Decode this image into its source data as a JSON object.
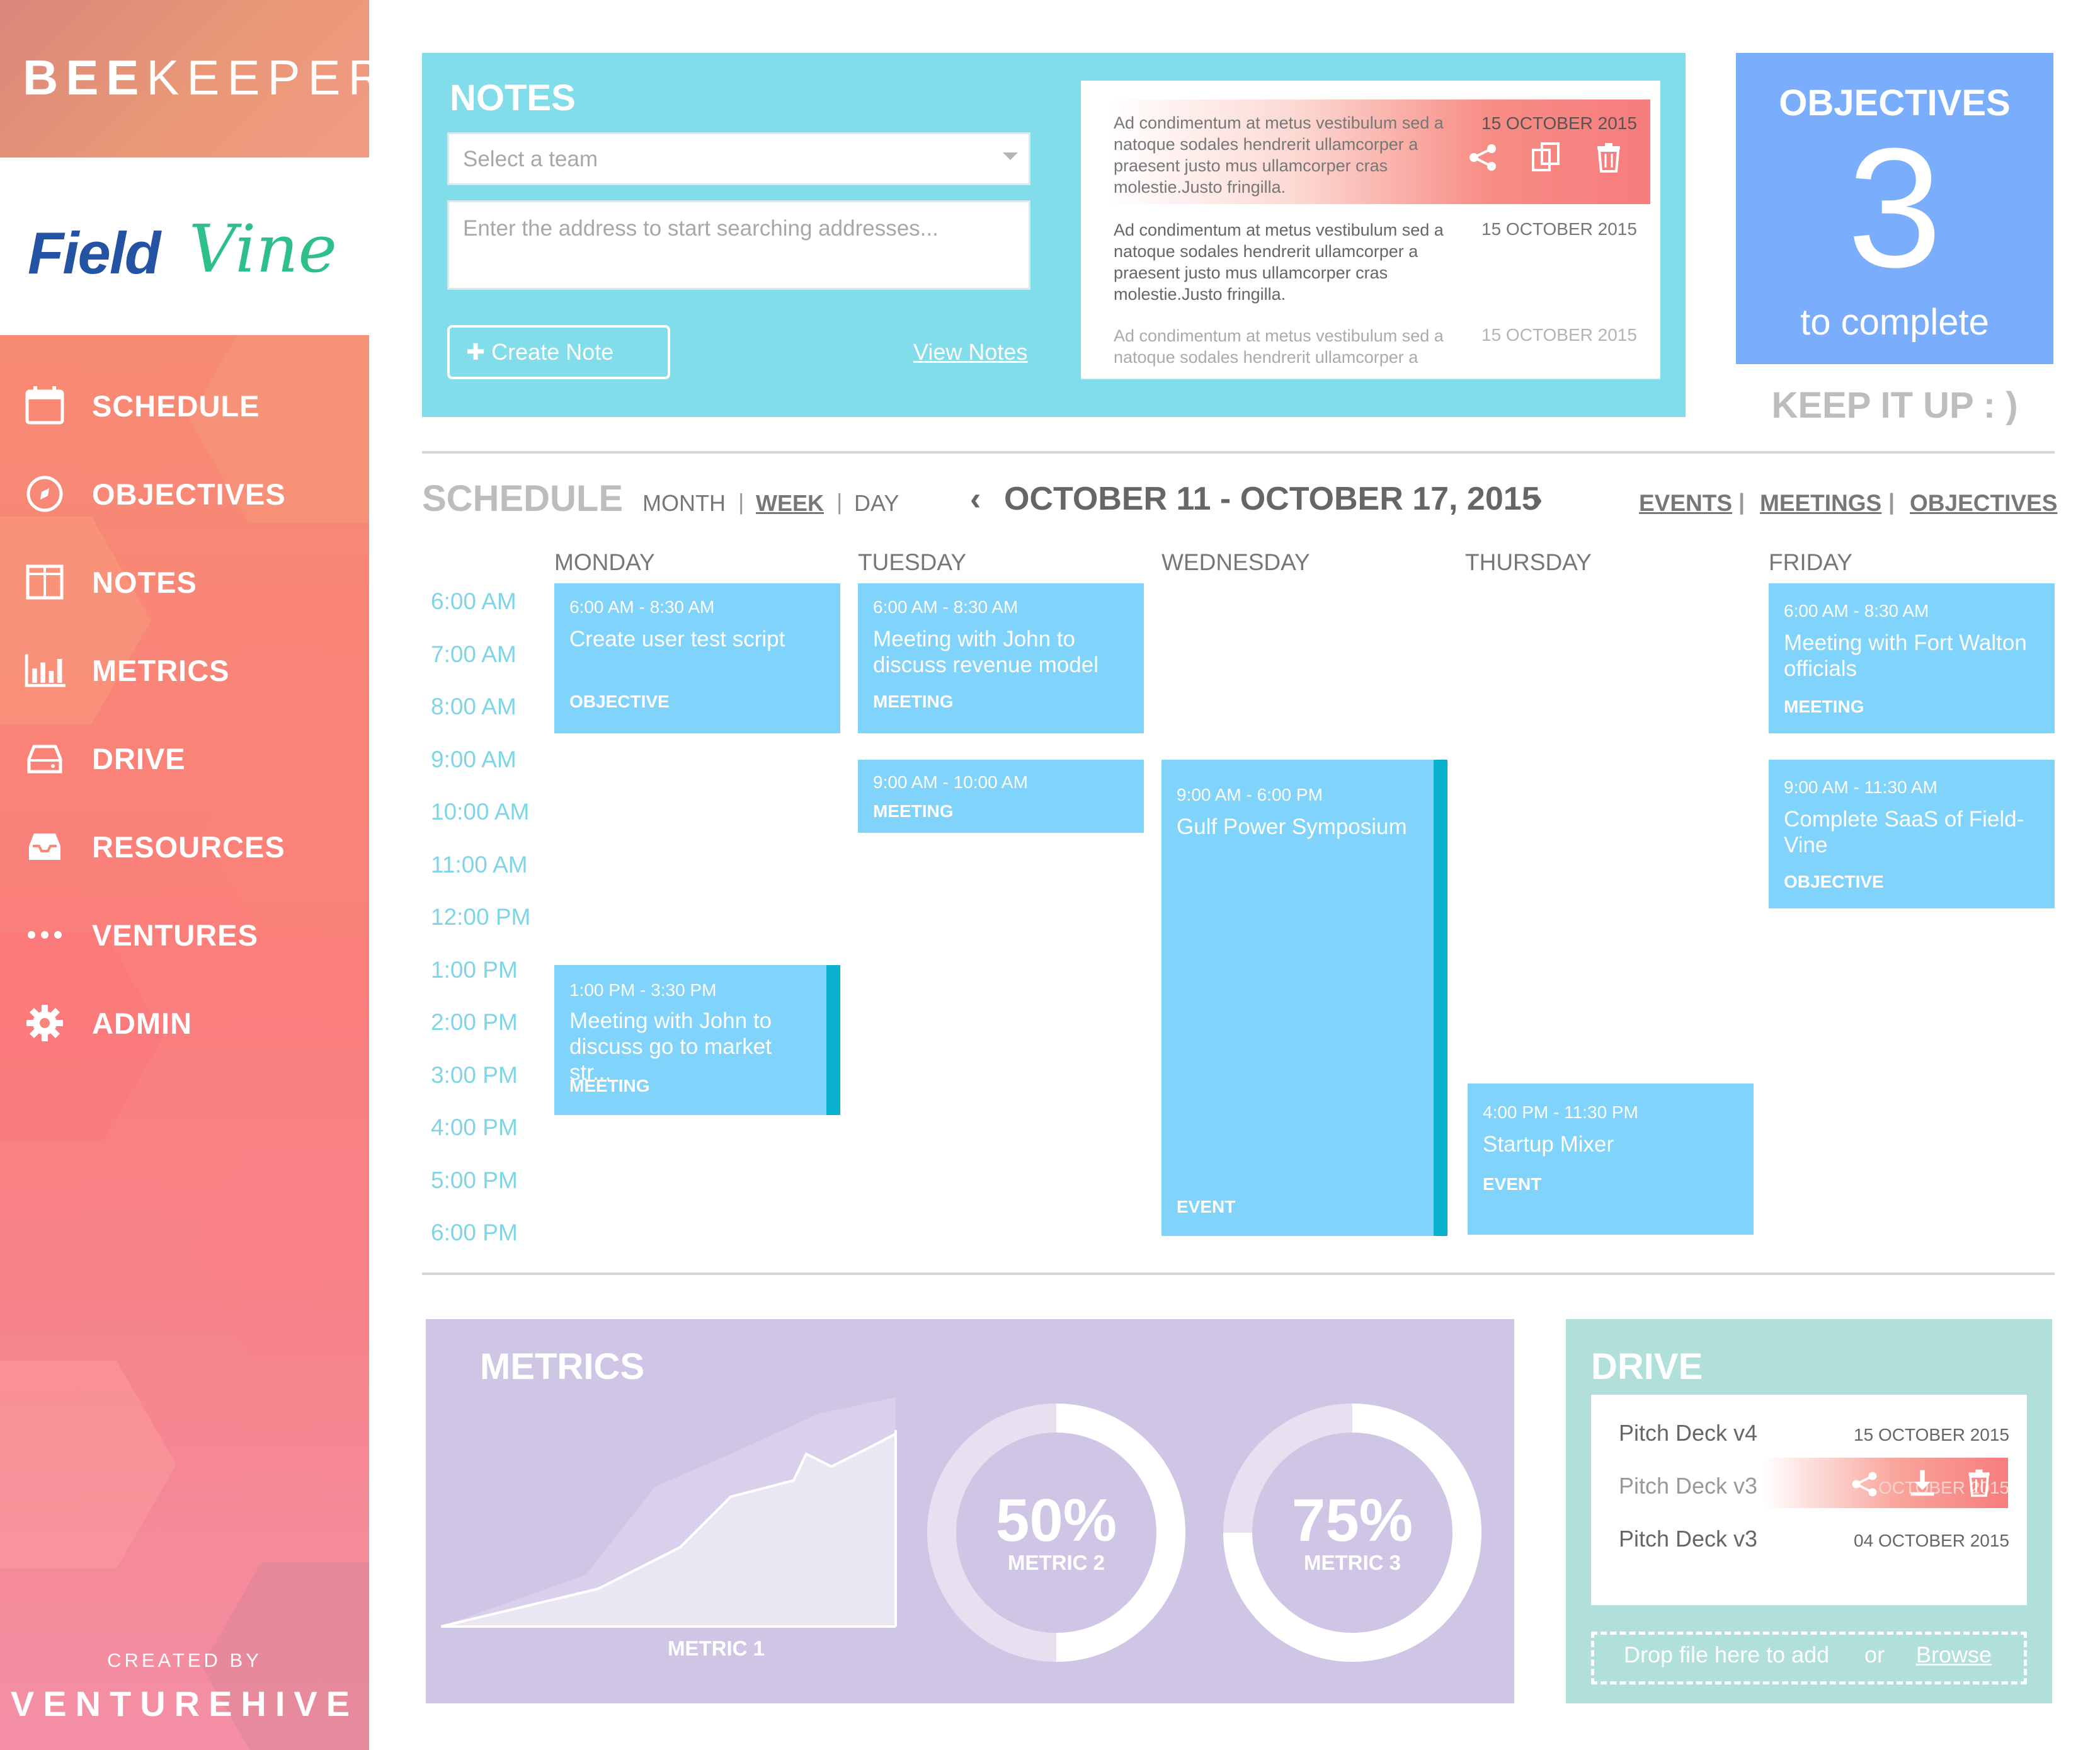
{
  "brand": {
    "name_bold": "BEE",
    "name_light": "KEEPER",
    "partner_part1": "Field",
    "partner_part2": "Vine"
  },
  "nav": [
    {
      "label": "SCHEDULE",
      "icon": "calendar-icon"
    },
    {
      "label": "OBJECTIVES",
      "icon": "compass-icon"
    },
    {
      "label": "NOTES",
      "icon": "notes-icon"
    },
    {
      "label": "METRICS",
      "icon": "bar-chart-icon"
    },
    {
      "label": "DRIVE",
      "icon": "drive-icon"
    },
    {
      "label": "RESOURCES",
      "icon": "inbox-icon"
    },
    {
      "label": "VENTURES",
      "icon": "more-icon"
    },
    {
      "label": "ADMIN",
      "icon": "gear-icon"
    }
  ],
  "footer": {
    "created_by": "CREATED BY",
    "company": "VENTUREHIVE"
  },
  "notes": {
    "title": "NOTES",
    "team_placeholder": "Select a team",
    "address_placeholder": "Enter the address to start searching addresses...",
    "create_label": "✚ Create Note",
    "view_label": "View Notes",
    "items": [
      {
        "text": "Ad condimentum at metus vestibulum sed a natoque sodales hendrerit ullamcorper a praesent justo mus ullamcorper cras molestie.Justo fringilla.",
        "date": "15 OCTOBER 2015"
      },
      {
        "text": "Ad condimentum at metus vestibulum sed a natoque sodales hendrerit ullamcorper a praesent justo mus ullamcorper cras molestie.Justo fringilla.",
        "date": "15 OCTOBER 2015"
      },
      {
        "text": "Ad condimentum at metus vestibulum sed a natoque sodales hendrerit ullamcorper a",
        "date": "15 OCTOBER 2015"
      }
    ]
  },
  "objectives": {
    "title": "OBJECTIVES",
    "count": "3",
    "subtitle": "to complete",
    "motto": "KEEP IT UP : )"
  },
  "schedule": {
    "title": "SCHEDULE",
    "views": [
      "MONTH",
      "WEEK",
      "DAY"
    ],
    "active_view": "WEEK",
    "range": "OCTOBER 11 - OCTOBER 17, 2015",
    "filters": [
      "EVENTS",
      "MEETINGS",
      "OBJECTIVES"
    ],
    "days": [
      "MONDAY",
      "TUESDAY",
      "WEDNESDAY",
      "THURSDAY",
      "FRIDAY"
    ],
    "times": [
      "6:00 AM",
      "7:00 AM",
      "8:00 AM",
      "9:00 AM",
      "10:00 AM",
      "11:00 AM",
      "12:00 PM",
      "1:00 PM",
      "2:00 PM",
      "3:00 PM",
      "4:00 PM",
      "5:00 PM",
      "6:00 PM"
    ],
    "events": [
      {
        "time": "6:00 AM - 8:30 AM",
        "name": "Create user test script",
        "kind": "OBJECTIVE"
      },
      {
        "time": "6:00 AM - 8:30 AM",
        "name": "Meeting with John to discuss revenue model",
        "kind": "MEETING"
      },
      {
        "time": "9:00 AM - 10:00 AM",
        "name": "",
        "kind": "MEETING"
      },
      {
        "time": "1:00 PM - 3:30 PM",
        "name": "Meeting with John to discuss go to market str...",
        "kind": "MEETING"
      },
      {
        "time": "9:00 AM - 6:00 PM",
        "name": "Gulf Power Symposium",
        "kind": "EVENT"
      },
      {
        "time": "4:00 PM - 11:30 PM",
        "name": "Startup Mixer",
        "kind": "EVENT"
      },
      {
        "time": "6:00 AM - 8:30 AM",
        "name": "Meeting with Fort Walton officials",
        "kind": "MEETING"
      },
      {
        "time": "9:00 AM - 11:30 AM",
        "name": "Complete SaaS of Field-Vine",
        "kind": "OBJECTIVE"
      }
    ]
  },
  "metrics": {
    "title": "METRICS",
    "metric1_label": "METRIC 1",
    "donuts": [
      {
        "value": "50%",
        "label": "METRIC 2",
        "fraction": 0.5
      },
      {
        "value": "75%",
        "label": "METRIC 3",
        "fraction": 0.75
      }
    ]
  },
  "drive": {
    "title": "DRIVE",
    "files": [
      {
        "name": "Pitch Deck v4",
        "date": "15 OCTOBER 2015"
      },
      {
        "name": "Pitch Deck v3",
        "date": "OCTOBER 2015"
      },
      {
        "name": "Pitch Deck v3",
        "date": "04 OCTOBER 2015"
      }
    ],
    "drop_text": "Drop file here to add",
    "or_text": "or",
    "browse_text": "Browse"
  },
  "colors": {
    "notes_bg": "#80dde9",
    "objectives_bg": "#7aaefc",
    "event_bg": "#80d3fa",
    "event_accent": "#0ab1cf",
    "metrics_bg": "#cfc6e6",
    "drive_bg": "#b0e0d9"
  }
}
